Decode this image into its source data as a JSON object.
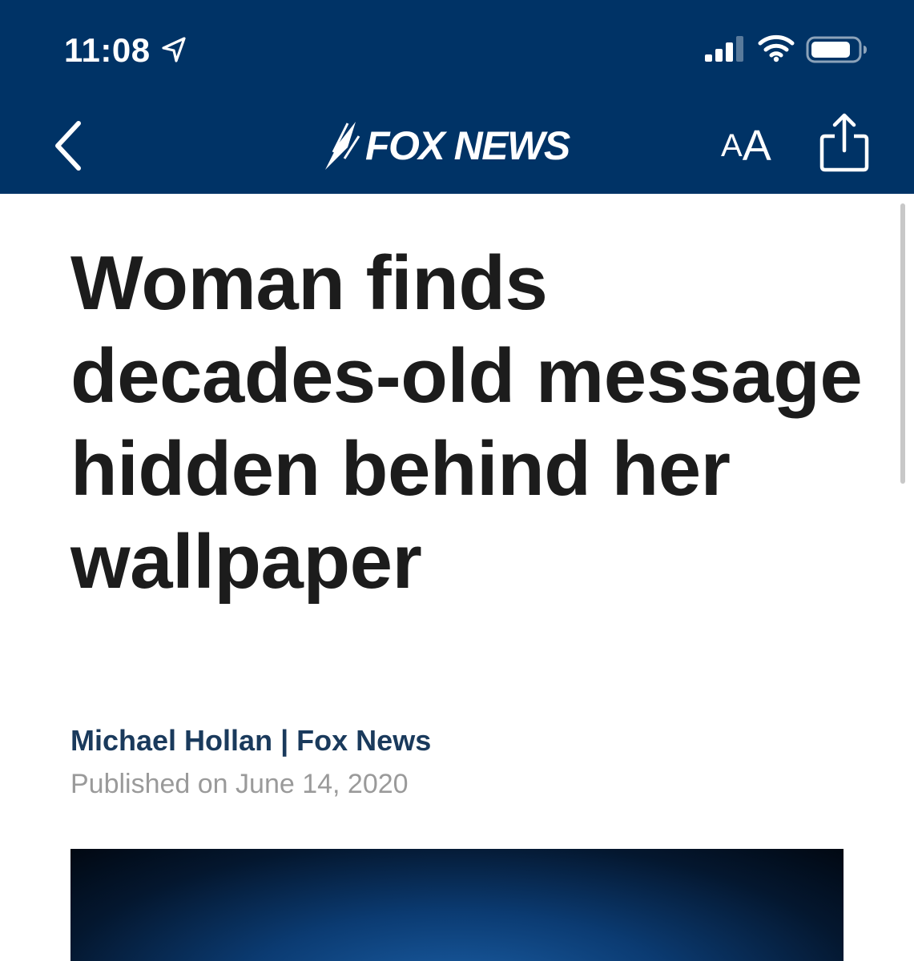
{
  "status_bar": {
    "time": "11:08",
    "icons": [
      "location-arrow-icon",
      "cellular-signal-icon",
      "wifi-icon",
      "battery-icon"
    ]
  },
  "nav": {
    "back_icon": "chevron-left-icon",
    "logo_text": "FOX NEWS",
    "text_size_small": "A",
    "text_size_large": "A",
    "share_icon": "share-icon",
    "background_color": "#003366"
  },
  "article": {
    "headline": "Woman finds decades-old message hidden behind her wallpaper",
    "author": "Michael Hollan",
    "separator": "|",
    "outlet": "Fox News",
    "published": "Published on June 14, 2020"
  },
  "colors": {
    "headline": "#1c1c1c",
    "byline": "#1a3a5c",
    "date": "#9a9a9a"
  }
}
